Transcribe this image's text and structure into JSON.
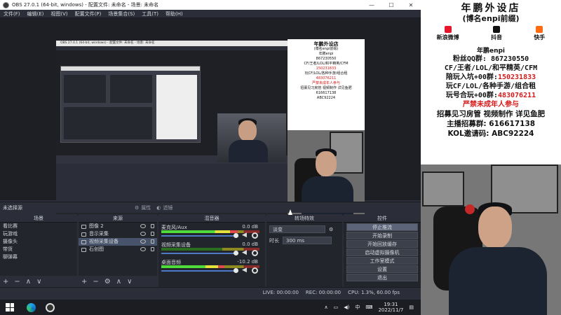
{
  "window": {
    "title": "OBS 27.0.1 (64-bit, windows) - 配置文件: 未命名 - 场景: 未命名",
    "controls": [
      "—",
      "☐",
      "✕"
    ]
  },
  "menu": [
    "文件(F)",
    "编辑(E)",
    "视图(V)",
    "配置文件(P)",
    "场景集合(S)",
    "工具(T)",
    "帮助(H)"
  ],
  "nested": {
    "title": "OBS 27.0.1 (64-bit, windows) - 配置文件: 未命名 - 场景: 未命名"
  },
  "sourcebar": {
    "label": "未选择源",
    "properties": "属性",
    "filters": "滤镜"
  },
  "docks": {
    "scenes": {
      "title": "场景",
      "items": [
        "看比赛",
        "玩游戏",
        "摄像头",
        "带货",
        "聊弹幕"
      ]
    },
    "sources": {
      "title": "来源",
      "items": [
        "图像 2",
        "音示采集",
        "视频采集设备",
        "石创图"
      ],
      "selected": 2
    },
    "mixer": {
      "title": "混音器",
      "channels": [
        {
          "name": "麦克风/Aux",
          "value": "0.0 dB",
          "level": 0.78
        },
        {
          "name": "视频采集设备",
          "value": "0.0 dB",
          "level": 0.0
        },
        {
          "name": "桌面音频",
          "value": "-10.2 dB",
          "level": 0.64
        }
      ]
    },
    "transitions": {
      "title": "转场特效",
      "type": "淡变",
      "duration_label": "时长",
      "duration": "300 ms"
    },
    "controls": {
      "title": "控件",
      "buttons": [
        "停止推流",
        "开始录制",
        "开始回放缓存",
        "启动虚拟摄像机",
        "工作室模式",
        "设置",
        "退出"
      ]
    }
  },
  "status": {
    "live": "LIVE: 00:00:00",
    "rec": "REC: 00:00:00",
    "cpu": "CPU: 1.3%, 60.00 fps"
  },
  "taskbar": {
    "ime": "中",
    "time": "19:31",
    "date": "2022/11/7"
  },
  "poster": {
    "title": "年鹏外设店",
    "subtitle": "(博名enpi前缀)",
    "social": [
      {
        "name": "新浪微博",
        "color": "#e6162d"
      },
      {
        "name": "抖音",
        "color": "#111111"
      },
      {
        "name": "快手",
        "color": "#ff6a13"
      }
    ],
    "nick": "年鹏enpi",
    "fans_label": "粉丝QQ群:",
    "fans": "867230550",
    "games": "CF/王者/LOL/和平精英/CFM",
    "pve_label": "陪玩入坑+00群:",
    "pve": "150231833",
    "play": "玩CF/LOL/各种手游/组合租",
    "group_label": "玩号合玩+00群:",
    "group": "483076211",
    "warn": "严禁未成年人参与",
    "recruit": "招募见习房管 视频制作 详见鱼肥",
    "anchor_label": "主播招募群:",
    "anchor": "616617138",
    "kol_label": "KOL邀请码:",
    "kol": "ABC92224"
  }
}
